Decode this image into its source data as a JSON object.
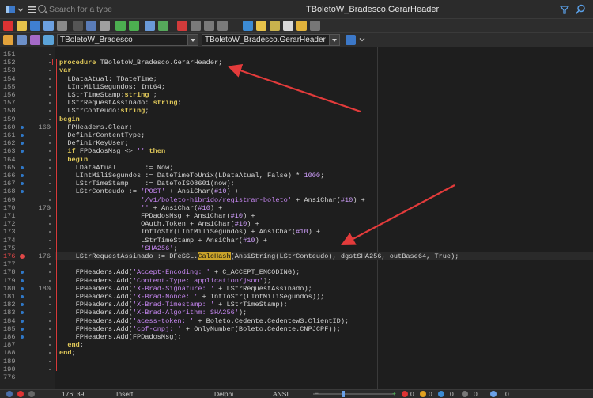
{
  "window": {
    "search_placeholder": "Search for a type",
    "title": "TBoletoW_Bradesco.GerarHeader"
  },
  "selectors": {
    "class_combo": "TBoletoW_Bradesco",
    "method_combo": "TBoletoW_Bradesco.GerarHeader"
  },
  "status": {
    "position": "176: 39",
    "mode": "Insert",
    "language": "Delphi",
    "encoding": "ANSI",
    "counters": [
      "0",
      "0",
      "0",
      "0",
      "0"
    ]
  },
  "colors": {
    "keyword": "#e2ca5a",
    "string": "#c586f0",
    "annotation_arrow": "#e33b3b",
    "highlight": "#c9a22a"
  },
  "lines": [
    {
      "n": "151",
      "m": false,
      "d": "",
      "t": ""
    },
    {
      "n": "152",
      "m": false,
      "d": "",
      "t": "procedure TBoletoW_Bradesco.GerarHeader;"
    },
    {
      "n": "153",
      "m": false,
      "d": "",
      "t": "var"
    },
    {
      "n": "154",
      "m": false,
      "d": "",
      "t": "  LDataAtual: TDateTime;"
    },
    {
      "n": "155",
      "m": false,
      "d": "",
      "t": "  LIntMiliSegundos: Int64;"
    },
    {
      "n": "156",
      "m": false,
      "d": "",
      "t": "  LStrTimeStamp:string ;"
    },
    {
      "n": "157",
      "m": false,
      "d": "",
      "t": "  LStrRequestAssinado: string;"
    },
    {
      "n": "158",
      "m": false,
      "d": "",
      "t": "  LStrConteudo:string;"
    },
    {
      "n": "159",
      "m": false,
      "d": "",
      "t": "begin"
    },
    {
      "n": "160",
      "m": true,
      "d": "160",
      "t": "  FPHeaders.Clear;"
    },
    {
      "n": "161",
      "m": true,
      "d": "",
      "t": "  DefinirContentType;"
    },
    {
      "n": "162",
      "m": true,
      "d": "",
      "t": "  DefinirKeyUser;"
    },
    {
      "n": "163",
      "m": true,
      "d": "",
      "t": "  if FPDadosMsg <> '' then"
    },
    {
      "n": "164",
      "m": false,
      "d": "",
      "t": "  begin"
    },
    {
      "n": "165",
      "m": true,
      "d": "",
      "t": "    LDataAtual       := Now;"
    },
    {
      "n": "166",
      "m": true,
      "d": "",
      "t": "    LIntMiliSegundos := DateTimeToUnix(LDataAtual, False) * 1000;"
    },
    {
      "n": "167",
      "m": true,
      "d": "",
      "t": "    LStrTimeStamp    := DateToISO8601(now);"
    },
    {
      "n": "168",
      "m": true,
      "d": "",
      "t": "    LStrConteudo := 'POST' + AnsiChar(#10) +"
    },
    {
      "n": "169",
      "m": false,
      "d": "",
      "t": "                    '/v1/boleto-hibrido/registrar-boleto' + AnsiChar(#10) +"
    },
    {
      "n": "170",
      "m": false,
      "d": "170",
      "t": "                    '' + AnsiChar(#10) +"
    },
    {
      "n": "171",
      "m": false,
      "d": "",
      "t": "                    FPDadosMsg + AnsiChar(#10) +"
    },
    {
      "n": "172",
      "m": false,
      "d": "",
      "t": "                    OAuth.Token + AnsiChar(#10) +"
    },
    {
      "n": "173",
      "m": false,
      "d": "",
      "t": "                    IntToStr(LIntMiliSegundos) + AnsiChar(#10) +"
    },
    {
      "n": "174",
      "m": false,
      "d": "",
      "t": "                    LStrTimeStamp + AnsiChar(#10) +"
    },
    {
      "n": "175",
      "m": false,
      "d": "",
      "t": "                    'SHA256';"
    },
    {
      "n": "176",
      "m": true,
      "d": "176",
      "t": "    LStrRequestAssinado := DFeSSL.CalcHash(AnsiString(LStrConteudo), dgstSHA256, outBase64, True);"
    },
    {
      "n": "177",
      "m": false,
      "d": "",
      "t": ""
    },
    {
      "n": "178",
      "m": true,
      "d": "",
      "t": "    FPHeaders.Add('Accept-Encoding: ' + C_ACCEPT_ENCODING);"
    },
    {
      "n": "179",
      "m": true,
      "d": "",
      "t": "    FPHeaders.Add('Content-Type: application/json');"
    },
    {
      "n": "180",
      "m": true,
      "d": "180",
      "t": "    FPHeaders.Add('X-Brad-Signature: ' + LStrRequestAssinado);"
    },
    {
      "n": "181",
      "m": true,
      "d": "",
      "t": "    FPHeaders.Add('X-Brad-Nonce: ' + IntToStr(LIntMiliSegundos));"
    },
    {
      "n": "182",
      "m": true,
      "d": "",
      "t": "    FPHeaders.Add('X-Brad-Timestamp: ' + LStrTimeStamp);"
    },
    {
      "n": "183",
      "m": true,
      "d": "",
      "t": "    FPHeaders.Add('X-Brad-Algorithm: SHA256');"
    },
    {
      "n": "184",
      "m": true,
      "d": "",
      "t": "    FPHeaders.Add('acess-token: ' + Boleto.Cedente.CedenteWS.ClientID);"
    },
    {
      "n": "185",
      "m": true,
      "d": "",
      "t": "    FPHeaders.Add('cpf-cnpj: ' + OnlyNumber(Boleto.Cedente.CNPJCPF));"
    },
    {
      "n": "186",
      "m": true,
      "d": "",
      "t": "    FPHeaders.Add(FPDadosMsg);"
    },
    {
      "n": "187",
      "m": false,
      "d": "",
      "t": "  end;"
    },
    {
      "n": "188",
      "m": false,
      "d": "",
      "t": "end;"
    },
    {
      "n": "189",
      "m": false,
      "d": "",
      "t": ""
    },
    {
      "n": "190",
      "m": false,
      "d": "",
      "t": ""
    },
    {
      "n": "776",
      "m": false,
      "d": "",
      "t": ""
    }
  ]
}
